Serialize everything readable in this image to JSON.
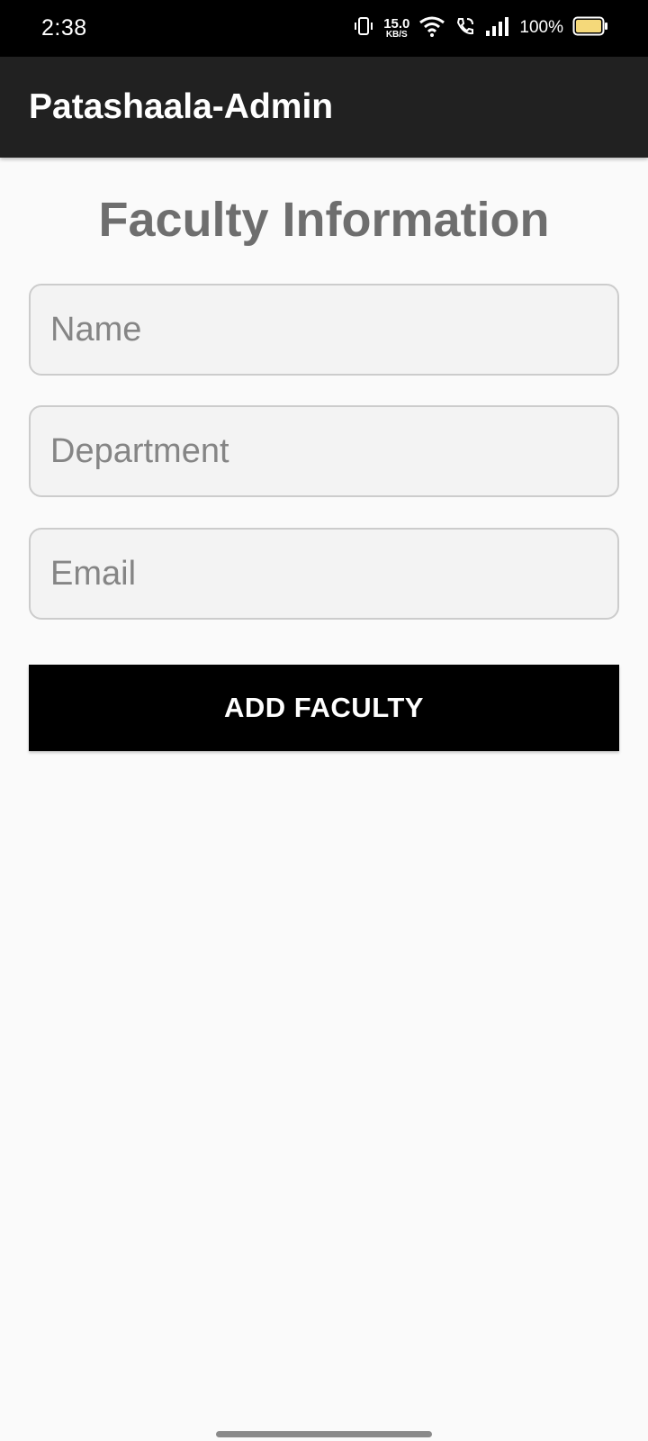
{
  "status_bar": {
    "time": "2:38",
    "net_speed_value": "15.0",
    "net_speed_unit": "KB/S",
    "battery_percent": "100%",
    "icons": [
      "vibrate-icon",
      "wifi-icon",
      "wifi-calling-icon",
      "signal-icon",
      "battery-icon"
    ],
    "battery_color": "#f5d97a"
  },
  "app_bar": {
    "title": "Patashaala-Admin"
  },
  "form": {
    "heading": "Faculty Information",
    "name_placeholder": "Name",
    "name_value": "",
    "department_placeholder": "Department",
    "department_value": "",
    "email_placeholder": "Email",
    "email_value": "",
    "submit_label": "ADD FACULTY"
  },
  "colors": {
    "app_bar_bg": "#212121",
    "status_bar_bg": "#000000",
    "page_bg": "#fafafa",
    "heading": "#6e6e6e",
    "button_bg": "#000000",
    "button_text": "#ffffff"
  }
}
